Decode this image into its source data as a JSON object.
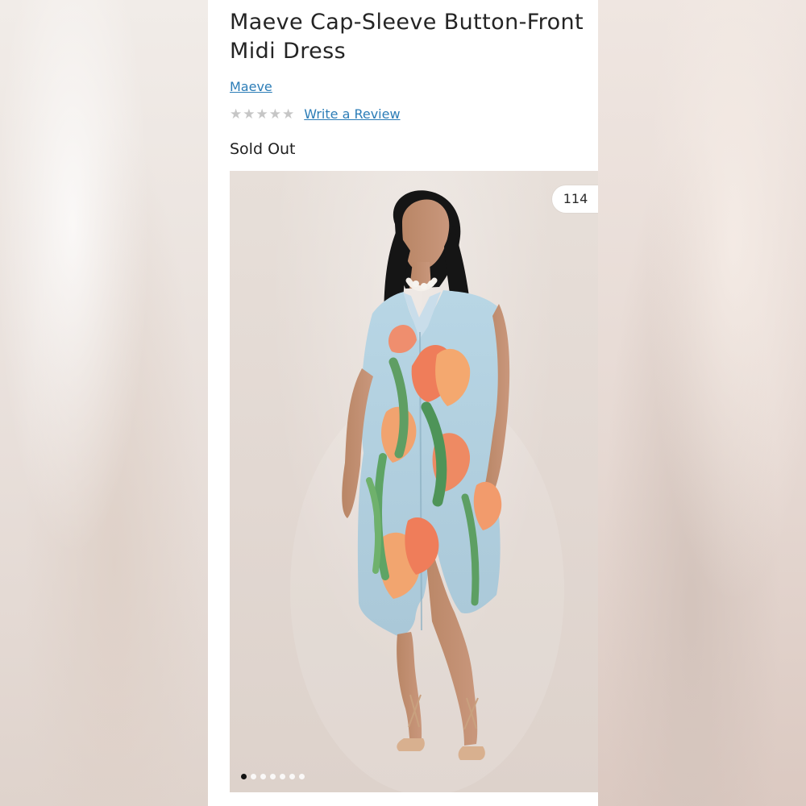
{
  "product": {
    "title_line1": "Maeve Cap-Sleeve Button-Front",
    "title_line2": "Midi Dress",
    "brand": "Maeve",
    "review_cta": "Write a Review",
    "status": "Sold Out",
    "rating_value": 0,
    "rating_max": 5,
    "image_count_badge": "114",
    "carousel_total": 7,
    "carousel_active_index": 1
  },
  "colors": {
    "link": "#2c7db7",
    "text": "#242424",
    "star_empty": "#c6c6c6",
    "image_bg": "#e2d8d2"
  },
  "icons": {
    "rating_star": "star-outline-icon",
    "carousel_indicator": "dot-icon"
  }
}
